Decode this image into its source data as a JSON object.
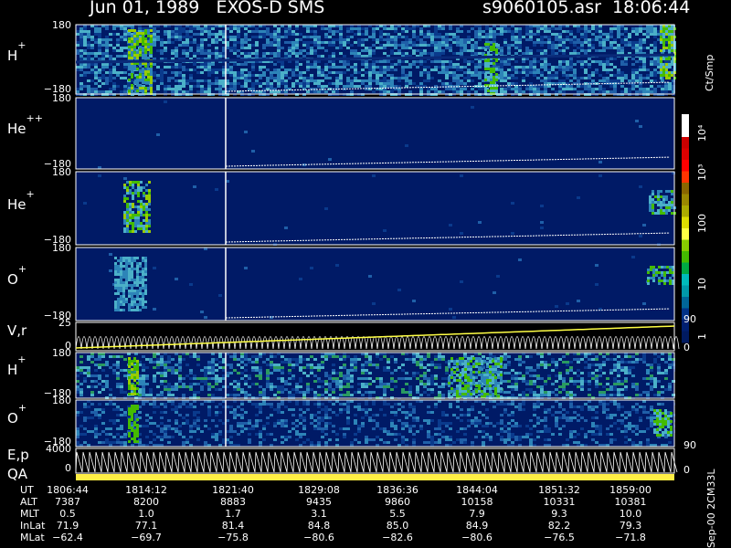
{
  "header": {
    "title": "Jun 01, 1989   EXOS-D SMS",
    "fileinfo": "s9060105.asr  18:06:44"
  },
  "panels": [
    {
      "id": "h1",
      "label": "H",
      "sup": "+",
      "ticks": [
        "180",
        "−180"
      ]
    },
    {
      "id": "he2",
      "label": "He",
      "sup": "++",
      "ticks": [
        "180",
        "−180"
      ]
    },
    {
      "id": "he1",
      "label": "He",
      "sup": "+",
      "ticks": [
        "180",
        "−180"
      ]
    },
    {
      "id": "o1",
      "label": "O",
      "sup": "+",
      "ticks": [
        "180",
        "−180"
      ]
    },
    {
      "id": "vr",
      "label": "V,r",
      "sup": "",
      "ticks": [
        "25",
        "0"
      ],
      "rticks": [
        "90",
        "0"
      ]
    },
    {
      "id": "h2",
      "label": "H",
      "sup": "+",
      "ticks": [
        "180",
        "−180"
      ]
    },
    {
      "id": "o2",
      "label": "O",
      "sup": "+",
      "ticks": [
        "180",
        "−180"
      ]
    },
    {
      "id": "ep",
      "label": "E,p",
      "sup": "",
      "ticks": [
        "4000",
        "0"
      ],
      "rticks": [
        "90",
        "0"
      ]
    },
    {
      "id": "qa",
      "label": "QA",
      "sup": "",
      "ticks": []
    }
  ],
  "colorbar": {
    "units": "Ct/Smp",
    "labels": [
      "10⁴",
      "10³",
      "100",
      "10",
      "1"
    ],
    "colors": [
      "#ffffff",
      "#ffffff",
      "#cc0000",
      "#dd0000",
      "#ff0000",
      "#ff3300",
      "#886600",
      "#998800",
      "#aaaa00",
      "#dddd00",
      "#ffff44",
      "#88cc00",
      "#44bb00",
      "#00aa44",
      "#00bbbb",
      "#0099aa",
      "#006699",
      "#003388",
      "#001f70",
      "#001a60"
    ]
  },
  "chart_data": {
    "type": "heatmap",
    "title": "Jun 01, 1989   EXOS-D SMS",
    "x_axis": "UT",
    "rows": [
      {
        "name": "UT",
        "values": [
          "1806:44",
          "1814:12",
          "1821:40",
          "1829:08",
          "1836:36",
          "1844:04",
          "1851:32",
          "1859:00"
        ]
      },
      {
        "name": "ALT",
        "values": [
          "7387",
          "8200",
          "8883",
          "9435",
          "9860",
          "10158",
          "10331",
          "10381"
        ]
      },
      {
        "name": "MLT",
        "values": [
          "0.5",
          "1.0",
          "1.7",
          "3.1",
          "5.5",
          "7.9",
          "9.3",
          "10.0"
        ]
      },
      {
        "name": "InLat",
        "values": [
          "71.9",
          "77.1",
          "81.4",
          "84.8",
          "85.0",
          "84.9",
          "82.2",
          "79.3"
        ]
      },
      {
        "name": "MLat",
        "values": [
          "−62.4",
          "−69.7",
          "−75.8",
          "−80.6",
          "−82.6",
          "−80.6",
          "−76.5",
          "−71.8"
        ]
      }
    ],
    "colorbar_range": [
      1,
      10000
    ],
    "colorbar_scale": "log"
  },
  "footer": {
    "version": "Sep-00  2CM33L"
  }
}
